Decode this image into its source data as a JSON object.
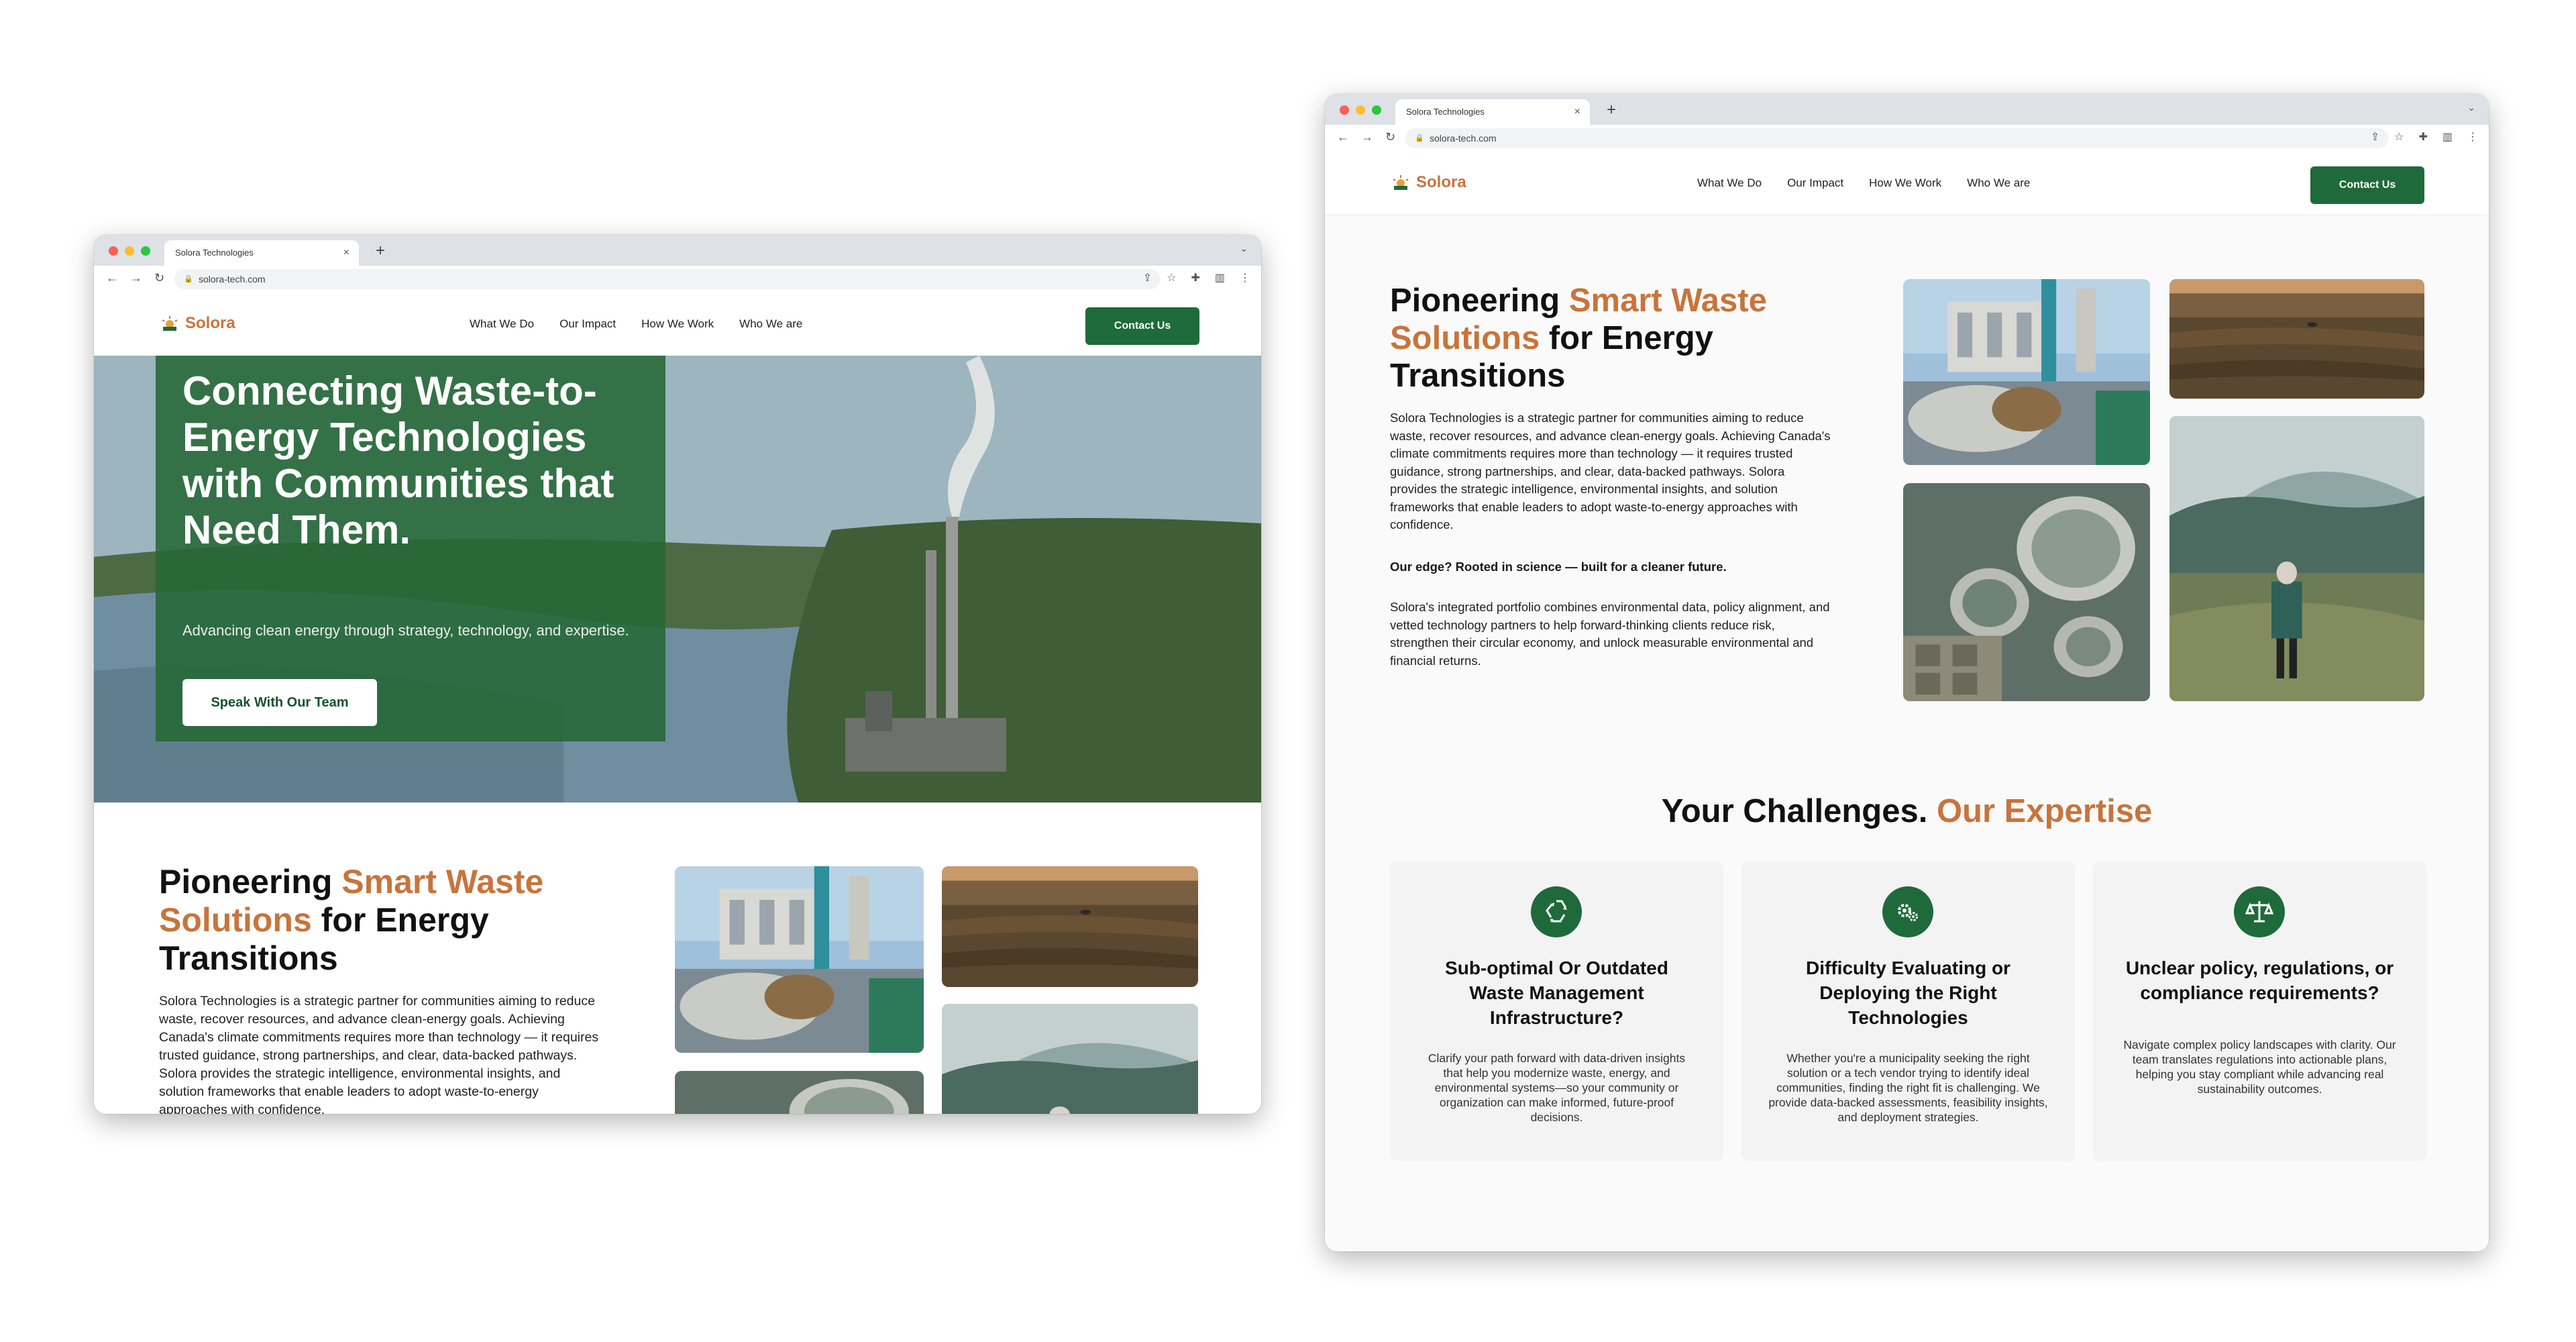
{
  "browser": {
    "tab_title": "Solora Technologies",
    "url": "solora-tech.com"
  },
  "nav": {
    "logo": "Solora",
    "items": [
      "What We Do",
      "Our Impact",
      "How We Work",
      "Who We are"
    ],
    "cta": "Contact Us"
  },
  "hero": {
    "title": "Connecting Waste-to-Energy Technologies with Communities that Need Them.",
    "subtitle": "Advancing clean energy through strategy, technology, and expertise.",
    "button": "Speak With Our Team"
  },
  "intro": {
    "title_prefix": "Pioneering ",
    "title_accent": "Smart Waste Solutions",
    "title_suffix": " for Energy Transitions",
    "paragraph1": "Solora Technologies is a strategic partner for communities aiming to reduce waste, recover resources, and advance clean-energy goals. Achieving Canada's climate commitments requires more than technology — it requires trusted guidance, strong partnerships, and clear, data-backed pathways. Solora provides the strategic intelligence, environmental insights, and solution frameworks that enable leaders to adopt waste-to-energy approaches with confidence.",
    "edge": "Our edge? Rooted in science — built for a cleaner future.",
    "paragraph2": "Solora's integrated portfolio combines environmental data, policy alignment, and vetted technology partners to help forward-thinking clients reduce risk, strengthen their circular economy, and unlock measurable environmental and financial returns."
  },
  "challenges": {
    "title": "Your Challenges.",
    "title_accent": "Our Expertise",
    "cards": [
      {
        "icon": "recycle-icon",
        "title": "Sub-optimal Or Outdated Waste Management Infrastructure?",
        "desc": "Clarify your path forward with data-driven insights that help you modernize waste, energy, and environmental systems—so your community or organization can make informed, future-proof decisions."
      },
      {
        "icon": "gears-icon",
        "title": "Difficulty Evaluating or Deploying the Right Technologies",
        "desc": "Whether you're a municipality seeking the right solution or a tech vendor trying to identify ideal communities, finding the right fit is challenging. We provide data-backed assessments, feasibility insights, and deployment strategies."
      },
      {
        "icon": "scale-icon",
        "title": "Unclear policy, regulations, or compliance requirements?",
        "desc": "Navigate complex policy landscapes with clarity. Our team translates regulations into actionable plans, helping you stay compliant while advancing real sustainability outcomes."
      }
    ]
  },
  "colors": {
    "brand_green": "#1f6a3a",
    "accent_orange": "#c8743c",
    "hero_overlay": "#256836"
  }
}
